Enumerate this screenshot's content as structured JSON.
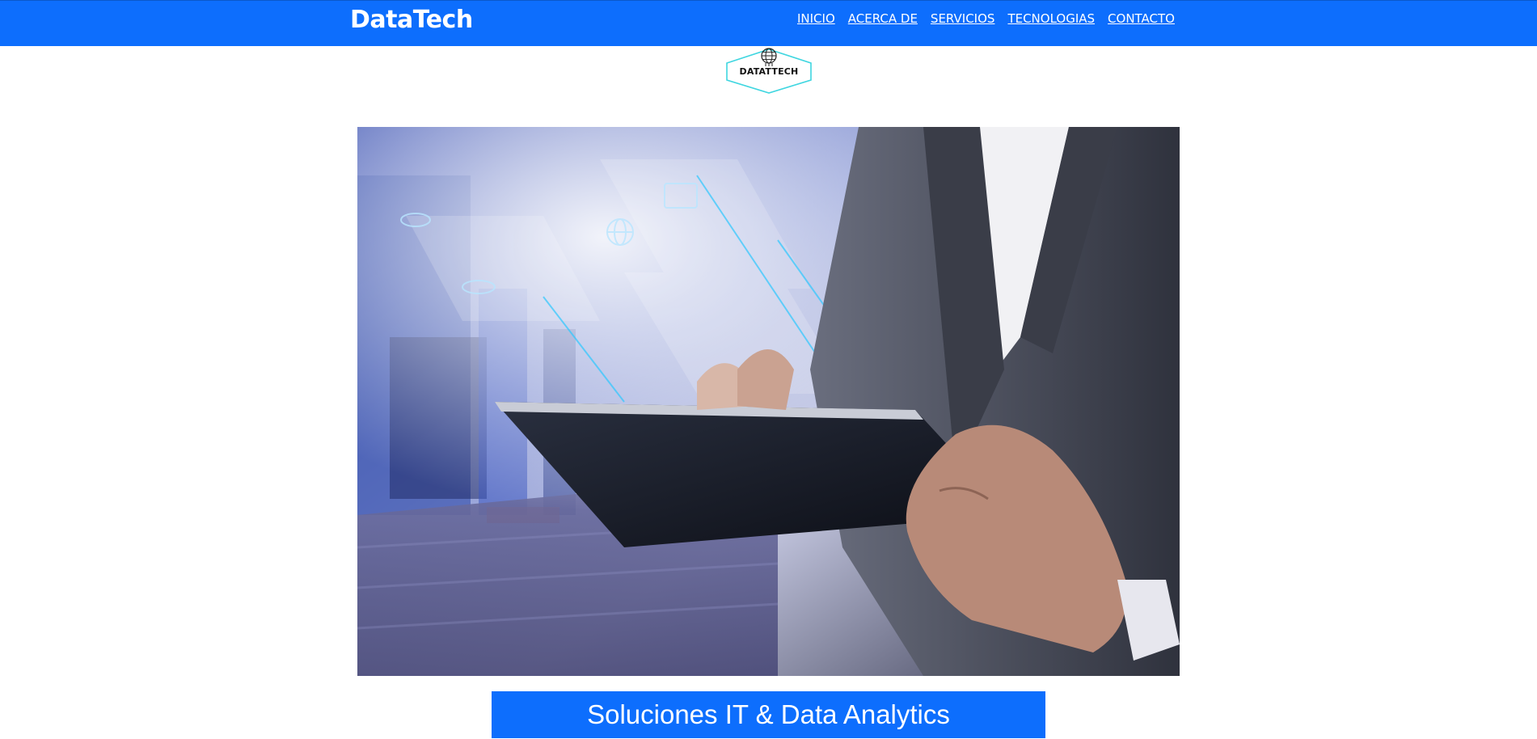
{
  "navbar": {
    "brand": "DataTech",
    "links": [
      "INICIO",
      "ACERCA DE",
      "SERVICIOS",
      "TECNOLOGIAS",
      "CONTACTO"
    ]
  },
  "logo": {
    "text": "DATATTECH",
    "icon": "globe-circuit-icon"
  },
  "hero": {
    "image": "businessman-holding-tablet-with-holographic-icons"
  },
  "caption": {
    "text": "Soluciones IT & Data Analytics"
  },
  "colors": {
    "primary": "#0d6efd",
    "logo_border": "#3fd6e0"
  }
}
